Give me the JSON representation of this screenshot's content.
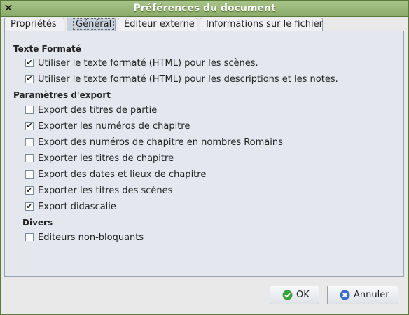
{
  "window": {
    "title": "Préférences du document"
  },
  "tabs": [
    {
      "label": "Propriétés",
      "active": false
    },
    {
      "label": "Général",
      "active": true
    },
    {
      "label": "Éditeur externe",
      "active": false
    },
    {
      "label": "Informations sur le fichier",
      "active": false
    }
  ],
  "sections": {
    "rich_text": {
      "title": "Texte Formaté"
    },
    "export": {
      "title": "Paramètres d'export"
    },
    "misc": {
      "title": "Divers"
    }
  },
  "options": {
    "rich_scenes": {
      "label": "Utiliser le texte formaté (HTML) pour les scènes.",
      "checked": true
    },
    "rich_notes": {
      "label": "Utiliser le texte formaté (HTML) pour les descriptions et les notes.",
      "checked": true
    },
    "export_part_titles": {
      "label": "Export des titres de partie",
      "checked": false
    },
    "export_chapter_numbers": {
      "label": "Exporter les numéros de chapitre",
      "checked": true
    },
    "export_roman_numbers": {
      "label": "Export des numéros de chapitre en nombres Romains",
      "checked": false
    },
    "export_chapter_titles": {
      "label": "Exporter les titres de chapitre",
      "checked": false
    },
    "export_dates_places": {
      "label": "Export des dates et lieux de chapitre",
      "checked": false
    },
    "export_scene_titles": {
      "label": "Exporter les titres des scènes",
      "checked": true
    },
    "export_didascalia": {
      "label": "Export didascalie",
      "checked": true
    },
    "non_blocking_editors": {
      "label": "Editeurs non-bloquants",
      "checked": false
    }
  },
  "buttons": {
    "ok": {
      "label": "OK"
    },
    "cancel": {
      "label": "Annuler"
    }
  },
  "colors": {
    "titlebar": "#98b878",
    "ok_icon": "#3aa03a",
    "cancel_icon": "#3a6ec8"
  }
}
